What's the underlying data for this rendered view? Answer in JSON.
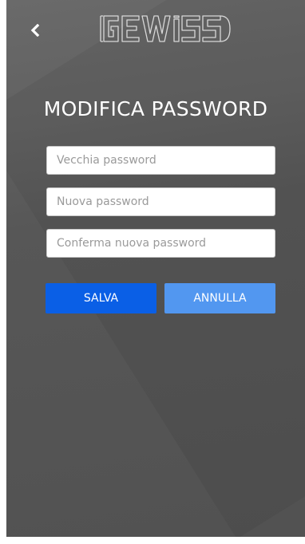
{
  "header": {
    "back_icon": "chevron-left-icon",
    "logo_text": "GEWISS"
  },
  "page": {
    "title": "MODIFICA PASSWORD"
  },
  "form": {
    "old_password": {
      "placeholder": "Vecchia password",
      "value": ""
    },
    "new_password": {
      "placeholder": "Nuova password",
      "value": ""
    },
    "confirm_password": {
      "placeholder": "Conferma nuova password",
      "value": ""
    }
  },
  "actions": {
    "save_label": "SALVA",
    "cancel_label": "ANNULLA"
  },
  "colors": {
    "background": "#575757",
    "save_button": "#0a5fe6",
    "cancel_button": "#5297f0",
    "text": "#ffffff"
  }
}
